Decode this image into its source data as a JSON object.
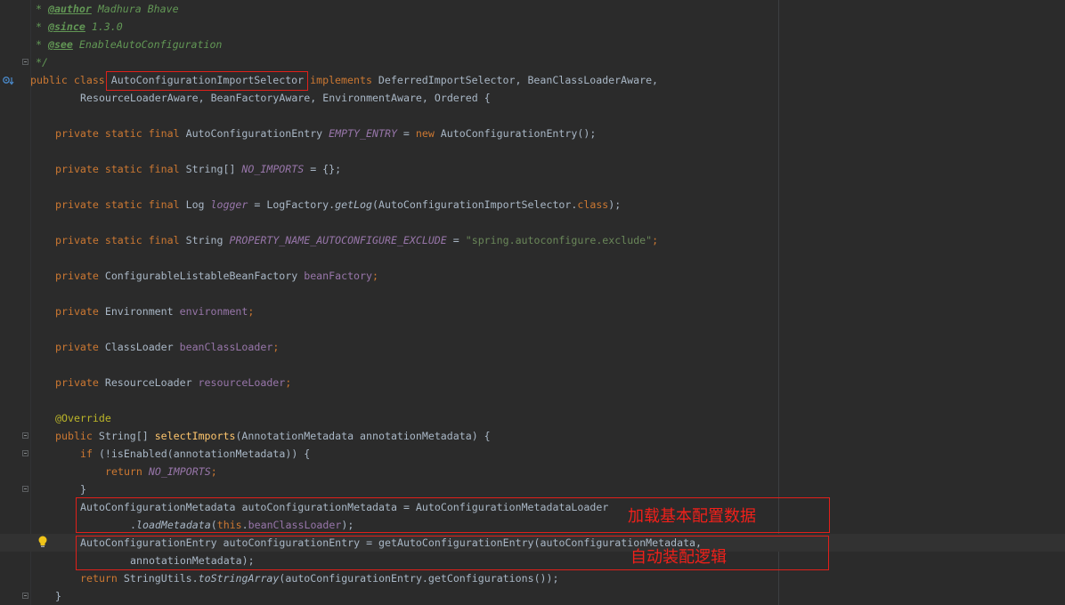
{
  "code": {
    "l1": [
      "* ",
      "@author",
      " Madhura Bhave"
    ],
    "l2": [
      "* ",
      "@since",
      " 1.3.0"
    ],
    "l3": [
      "* ",
      "@see",
      " EnableAutoConfiguration"
    ],
    "l4": "*/",
    "l5": [
      "public ",
      "class ",
      "AutoConfigurationImportSelector",
      " implements ",
      "DeferredImportSelector, BeanClassLoaderAware,"
    ],
    "l6": "ResourceLoaderAware, BeanFactoryAware, EnvironmentAware, Ordered {",
    "l7": [
      "private static final ",
      "AutoConfigurationEntry ",
      "EMPTY_ENTRY",
      " = ",
      "new ",
      "AutoConfigurationEntry();"
    ],
    "l8": [
      "private static final ",
      "String[] ",
      "NO_IMPORTS",
      " = {};"
    ],
    "l9": [
      "private static final ",
      "Log ",
      "logger",
      " = LogFactory.",
      "getLog",
      "(AutoConfigurationImportSelector.",
      "class",
      ");"
    ],
    "l10": [
      "private static final ",
      "String ",
      "PROPERTY_NAME_AUTOCONFIGURE_EXCLUDE",
      " = ",
      "\"spring.autoconfigure.exclude\"",
      ";"
    ],
    "l11": [
      "private ",
      "ConfigurableListableBeanFactory ",
      "beanFactory",
      ";"
    ],
    "l12": [
      "private ",
      "Environment ",
      "environment",
      ";"
    ],
    "l13": [
      "private ",
      "ClassLoader ",
      "beanClassLoader",
      ";"
    ],
    "l14": [
      "private ",
      "ResourceLoader ",
      "resourceLoader",
      ";"
    ],
    "l15": "@Override",
    "l16": [
      "public ",
      "String[] ",
      "selectImports",
      "(AnnotationMetadata annotationMetadata) {"
    ],
    "l17": [
      "if ",
      "(!isEnabled(annotationMetadata)) {"
    ],
    "l18": [
      "return ",
      "NO_IMPORTS",
      ";"
    ],
    "l19": "}",
    "l20": "AutoConfigurationMetadata autoConfigurationMetadata = AutoConfigurationMetadataLoader",
    "l21": [
      ".",
      "loadMetadata",
      "(",
      "this",
      ".",
      "beanClassLoader",
      ");"
    ],
    "l22": "AutoConfigurationEntry autoConfigurationEntry = getAutoConfigurationEntry(autoConfigurationMetadata,",
    "l23": "annotationMetadata);",
    "l24": [
      "return ",
      "StringUtils.",
      "toStringArray",
      "(autoConfigurationEntry.getConfigurations());"
    ],
    "l25": "}"
  },
  "annotations": {
    "note1": "加载基本配置数据",
    "note2": "自动装配逻辑"
  },
  "icons": {
    "gutter_impl": "implementation-marker-icon",
    "intention": "lightbulb-icon"
  },
  "colors": {
    "background": "#2b2b2b",
    "keyword": "#cc7832",
    "doc_comment": "#629755",
    "field": "#9876aa",
    "string": "#6a8759",
    "annotation": "#bbb529",
    "method_decl": "#ffc66d",
    "text": "#a9b7c6",
    "highlight_box": "#e0201a"
  }
}
